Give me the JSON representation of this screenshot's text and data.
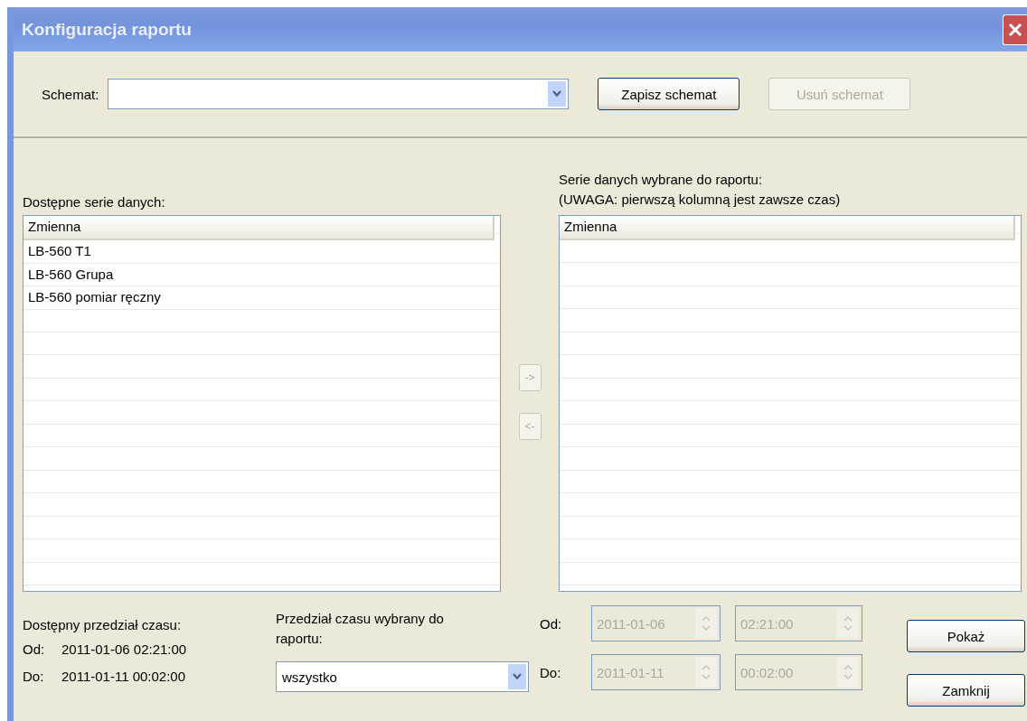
{
  "window": {
    "title": "Konfiguracja raportu"
  },
  "schema": {
    "label": "Schemat:"
  },
  "schema_buttons": [
    {
      "label": "Zapisz schemat",
      "disabled": false
    },
    {
      "label": "Usuń schemat",
      "disabled": true
    }
  ],
  "available": {
    "label": "Dostępne serie danych:",
    "column": "Zmienna",
    "rows": [
      "LB-560 T1",
      "LB-560 Grupa",
      "LB-560 pomiar ręczny"
    ]
  },
  "chosen": {
    "labels": [
      "Serie danych wybrane do raportu:",
      "(UWAGA: pierwszą kolumną jest zawsze czas)"
    ],
    "column": "Zmienna"
  },
  "move_buttons": [
    {
      "label": "->",
      "disabled": true
    },
    {
      "label": "<-",
      "disabled": true
    }
  ],
  "available_range": {
    "label": "Dostępny przedział czasu:",
    "rows": [
      {
        "label": "Od:",
        "value": "2011-01-06 02:21:00"
      },
      {
        "label": "Do:",
        "value": "2011-01-11 00:02:00"
      }
    ]
  },
  "report_range": {
    "label": "Przedział czasu wybrany do raportu:",
    "value": "wszystko"
  },
  "range_fields": [
    {
      "label": "Od:",
      "date": "2011-01-06",
      "time": "02:21:00",
      "disabled": true
    },
    {
      "label": "Do:",
      "date": "2011-01-11",
      "time": "00:02:00",
      "disabled": true
    }
  ],
  "actions": [
    {
      "label": "Pokaż"
    },
    {
      "label": "Zamknij"
    }
  ]
}
